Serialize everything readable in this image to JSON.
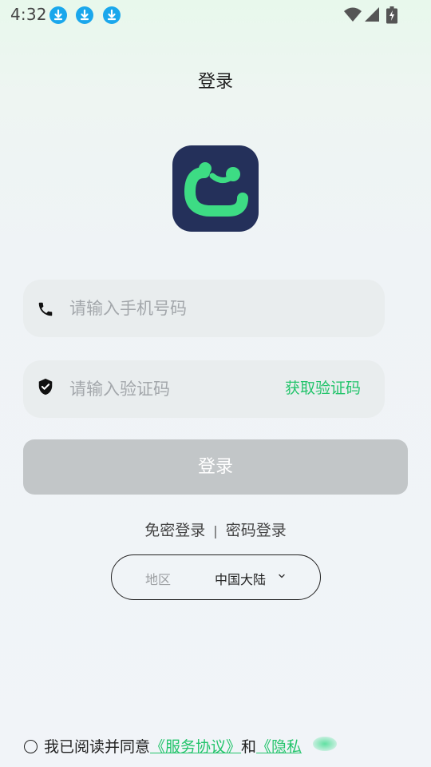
{
  "status_bar": {
    "time": "4:32",
    "download_icons": [
      "download-icon",
      "download-icon",
      "download-icon"
    ],
    "right_icons": [
      "wifi-icon",
      "cellular-signal-icon",
      "battery-icon"
    ],
    "colors": {
      "download_badge": "#1aa7ec"
    }
  },
  "header": {
    "title": "登录"
  },
  "logo": {
    "icon": "app-logo",
    "bg_color": "#24305a",
    "accent_color": "#3ddc84"
  },
  "phone": {
    "placeholder": "请输入手机号码",
    "value": "",
    "icon": "phone-icon"
  },
  "code": {
    "placeholder": "请输入验证码",
    "value": "",
    "icon": "shield-icon",
    "get_code_label": "获取验证码"
  },
  "login_button": {
    "label": "登录",
    "color": "#c2c6c8"
  },
  "alt_login": {
    "passwordless_label": "免密登录",
    "separator": "|",
    "password_label": "密码登录"
  },
  "region": {
    "label": "地区",
    "value": "中国大陆"
  },
  "agreement": {
    "prefix": "我已阅读并同意",
    "service_link": "《服务协议》",
    "and": "和",
    "privacy_link": "《隐私"
  },
  "colors": {
    "accent": "#23c46b"
  }
}
